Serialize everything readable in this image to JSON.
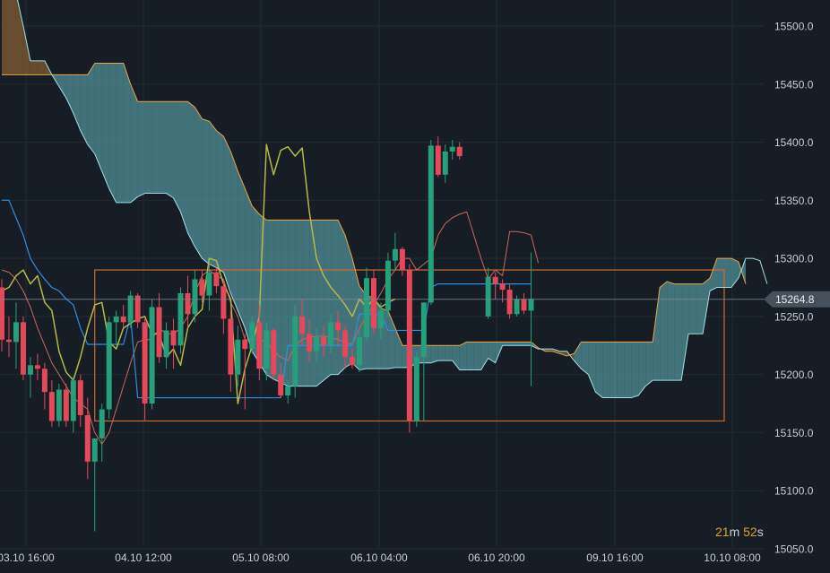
{
  "chart_data": {
    "type": "candlestick",
    "y_ticks": [
      "15500.0",
      "15450.0",
      "15400.0",
      "15350.0",
      "15300.0",
      "15250.0",
      "15200.0",
      "15150.0",
      "15100.0",
      "15050.0"
    ],
    "ylim": [
      15045,
      15517
    ],
    "x_ticks": [
      "03.10 16:00",
      "04.10 12:00",
      "05.10 08:00",
      "06.10 04:00",
      "06.10 20:00",
      "09.10 16:00",
      "10.10 08:00"
    ],
    "current_price": "15264.8",
    "grid": true,
    "colors": {
      "up": "#26a07a",
      "down": "#e5485a",
      "cloud_bear": "#7a5a30",
      "cloud_bull": "#4f8a90",
      "box": "#d06a2a",
      "kijun": "#2f8ee0",
      "chikou": "#b8b84a",
      "tenkan": "#c86a5a",
      "span_a": "#e6a64a",
      "span_b": "#9fe0e6"
    },
    "candles": [
      [
        15275,
        15282,
        15220,
        15230
      ],
      [
        15230,
        15250,
        15215,
        15228
      ],
      [
        15228,
        15262,
        15205,
        15245
      ],
      [
        15245,
        15250,
        15195,
        15200
      ],
      [
        15200,
        15215,
        15180,
        15208
      ],
      [
        15208,
        15218,
        15195,
        15205
      ],
      [
        15205,
        15210,
        15170,
        15185
      ],
      [
        15185,
        15195,
        15155,
        15160
      ],
      [
        15160,
        15192,
        15155,
        15187
      ],
      [
        15187,
        15192,
        15155,
        15160
      ],
      [
        15160,
        15198,
        15150,
        15195
      ],
      [
        15195,
        15200,
        15155,
        15165
      ],
      [
        15165,
        15180,
        15110,
        15125
      ],
      [
        15125,
        15140,
        15065,
        15145
      ],
      [
        15145,
        15175,
        15125,
        15170
      ],
      [
        15170,
        15250,
        15162,
        15245
      ],
      [
        15245,
        15255,
        15225,
        15250
      ],
      [
        15250,
        15260,
        15240,
        15245
      ],
      [
        15245,
        15272,
        15240,
        15268
      ],
      [
        15268,
        15270,
        15240,
        15245
      ],
      [
        15245,
        15248,
        15160,
        15175
      ],
      [
        15175,
        15265,
        15170,
        15258
      ],
      [
        15258,
        15270,
        15210,
        15215
      ],
      [
        15215,
        15245,
        15205,
        15238
      ],
      [
        15238,
        15248,
        15205,
        15225
      ],
      [
        15225,
        15275,
        15218,
        15270
      ],
      [
        15270,
        15285,
        15240,
        15252
      ],
      [
        15252,
        15290,
        15245,
        15282
      ],
      [
        15282,
        15290,
        15262,
        15268
      ],
      [
        15268,
        15295,
        15255,
        15288
      ],
      [
        15288,
        15292,
        15270,
        15276
      ],
      [
        15276,
        15280,
        15235,
        15248
      ],
      [
        15248,
        15255,
        15185,
        15200
      ],
      [
        15200,
        15242,
        15190,
        15230
      ],
      [
        15230,
        15235,
        15170,
        15222
      ],
      [
        15222,
        15250,
        15218,
        15245
      ],
      [
        15245,
        15260,
        15195,
        15205
      ],
      [
        15205,
        15245,
        15195,
        15238
      ],
      [
        15238,
        15240,
        15195,
        15200
      ],
      [
        15200,
        15210,
        15180,
        15182
      ],
      [
        15182,
        15195,
        15175,
        15190
      ],
      [
        15190,
        15260,
        15180,
        15250
      ],
      [
        15250,
        15265,
        15225,
        15235
      ],
      [
        15235,
        15248,
        15210,
        15220
      ],
      [
        15220,
        15240,
        15210,
        15232
      ],
      [
        15232,
        15242,
        15215,
        15225
      ],
      [
        15225,
        15252,
        15218,
        15245
      ],
      [
        15245,
        15255,
        15225,
        15238
      ],
      [
        15238,
        15242,
        15205,
        15215
      ],
      [
        15215,
        15222,
        15205,
        15208
      ],
      [
        15208,
        15238,
        15202,
        15232
      ],
      [
        15232,
        15292,
        15228,
        15283
      ],
      [
        15283,
        15290,
        15235,
        15240
      ],
      [
        15240,
        15262,
        15230,
        15255
      ],
      [
        15255,
        15305,
        15250,
        15298
      ],
      [
        15298,
        15322,
        15290,
        15308
      ],
      [
        15308,
        15310,
        15285,
        15290
      ],
      [
        15290,
        15295,
        15150,
        15160
      ],
      [
        15160,
        15220,
        15155,
        15215
      ],
      [
        15215,
        15262,
        15160,
        15262
      ],
      [
        15262,
        15402,
        15260,
        15397
      ],
      [
        15397,
        15405,
        15370,
        15372
      ],
      [
        15372,
        15398,
        15365,
        15392
      ],
      [
        15392,
        15402,
        15385,
        15396
      ],
      [
        15396,
        15400,
        15385,
        15388
      ],
      null,
      null,
      null,
      [
        15250,
        15292,
        15248,
        15284
      ],
      [
        15284,
        15288,
        15265,
        15278
      ],
      [
        15278,
        15282,
        15262,
        15273
      ],
      [
        15273,
        15278,
        15248,
        15252
      ],
      [
        15252,
        15268,
        15250,
        15265
      ],
      [
        15265,
        15270,
        15252,
        15255
      ],
      [
        15255,
        15305,
        15190,
        15265
      ]
    ],
    "kijun": [
      15350,
      15350,
      15335,
      15320,
      15300,
      15290,
      15282,
      15275,
      15272,
      15265,
      15260,
      15240,
      15226,
      15226,
      15226,
      15226,
      15226,
      15226,
      15250,
      15180,
      15180,
      15180,
      15180,
      15180,
      15180,
      15180,
      15180,
      15180,
      15180,
      15180,
      15180,
      15180,
      15180,
      15180,
      15180,
      15180,
      15180,
      15180,
      15180,
      15180,
      15225,
      15225,
      15225,
      15225,
      15225,
      15225,
      15225,
      15225,
      15225,
      15225,
      15252,
      15252,
      15252,
      15252,
      15238,
      15238,
      15238,
      15238,
      15238,
      15238,
      15275,
      15278,
      15278,
      15278,
      15278,
      15278,
      15278,
      15278,
      15278,
      15278,
      15278,
      15278,
      15278,
      15278,
      15278
    ],
    "tenkan": [
      15290,
      15288,
      15282,
      15272,
      15258,
      15240,
      15225,
      15210,
      15200,
      15190,
      15180,
      15175,
      15170,
      15150,
      15140,
      15150,
      15170,
      15190,
      15210,
      15228,
      15230,
      15230,
      15240,
      15235,
      15235,
      15240,
      15250,
      15270,
      15285,
      15290,
      15285,
      15282,
      15262,
      15250,
      15230,
      15230,
      15230,
      15228,
      15220,
      15215,
      15212,
      15225,
      15230,
      15232,
      15233,
      15233,
      15232,
      15230,
      15228,
      15226,
      15240,
      15250,
      15260,
      15270,
      15282,
      15290,
      15300,
      15300,
      15290,
      15295,
      15300,
      15320,
      15330,
      15335,
      15338,
      15340,
      15320,
      15300,
      15282,
      15290,
      15285,
      15323,
      15323,
      15322,
      15320,
      15296
    ],
    "chikou": [
      15272,
      15275,
      15285,
      15290,
      15278,
      15285,
      15262,
      15255,
      15220,
      15202,
      15195,
      15215,
      15240,
      15260,
      15262,
      15228,
      15222,
      15240,
      15244,
      15248,
      15250,
      15235,
      15235,
      15215,
      15222,
      15208,
      15240,
      15250,
      15256,
      15300,
      15298,
      15278,
      15265,
      15175,
      15205,
      15225,
      15250,
      15398,
      15372,
      15393,
      15396,
      15388,
      15395,
      15340,
      15300,
      15285,
      15275,
      15268,
      15260,
      15250,
      15265,
      15258,
      15265,
      15258,
      15262,
      15265
    ],
    "span_a": [
      15458,
      15458,
      15458,
      15458,
      15458,
      15458,
      15458,
      15458,
      15458,
      15458,
      15458,
      15458,
      15458,
      15468,
      15468,
      15468,
      15468,
      15468,
      15450,
      15435,
      15435,
      15435,
      15435,
      15435,
      15435,
      15435,
      15435,
      15430,
      15420,
      15418,
      15410,
      15405,
      15392,
      15375,
      15360,
      15345,
      15338,
      15333,
      15333,
      15333,
      15333,
      15333,
      15333,
      15333,
      15333,
      15333,
      15333,
      15333,
      15320,
      15300,
      15276,
      15268,
      15266,
      15257,
      15255,
      15240,
      15225,
      15225,
      15225,
      15225,
      15225,
      15225,
      15225,
      15225,
      15225,
      15228,
      15228,
      15228,
      15228,
      15228,
      15228,
      15228,
      15228,
      15228,
      15228,
      15223,
      15220,
      15220,
      15218,
      15216,
      15218,
      15228,
      15228,
      15228,
      15228,
      15228,
      15228,
      15228,
      15228,
      15228,
      15228,
      15228,
      15275,
      15280,
      15278,
      15278,
      15278,
      15278,
      15278,
      15283,
      15300,
      15300,
      15300,
      15297,
      15278
    ],
    "span_b": [
      15528,
      15528,
      15528,
      15500,
      15470,
      15470,
      15470,
      15458,
      15448,
      15438,
      15425,
      15410,
      15398,
      15390,
      15375,
      15360,
      15348,
      15348,
      15348,
      15353,
      15356,
      15356,
      15356,
      15356,
      15352,
      15340,
      15322,
      15310,
      15300,
      15295,
      15292,
      15288,
      15270,
      15255,
      15240,
      15220,
      15210,
      15200,
      15196,
      15193,
      15190,
      15190,
      15190,
      15190,
      15190,
      15195,
      15200,
      15200,
      15206,
      15210,
      15204,
      15205,
      15205,
      15205,
      15205,
      15206,
      15206,
      15206,
      15210,
      15210,
      15210,
      15212,
      15212,
      15212,
      15204,
      15204,
      15204,
      15204,
      15214,
      15210,
      15225,
      15225,
      15225,
      15225,
      15225,
      15222,
      15222,
      15222,
      15220,
      15220,
      15212,
      15205,
      15200,
      15185,
      15180,
      15180,
      15180,
      15180,
      15180,
      15182,
      15190,
      15195,
      15195,
      15195,
      15195,
      15195,
      15235,
      15235,
      15235,
      15272,
      15275,
      15275,
      15275,
      15283,
      15300,
      15300,
      15298,
      15278
    ],
    "box": {
      "from_index": 13,
      "to_index": 101,
      "y_low": 15160,
      "y_high": 15290
    }
  },
  "countdown": {
    "minutes": "21",
    "m_label": "m",
    "seconds": "52",
    "s_label": "s"
  }
}
